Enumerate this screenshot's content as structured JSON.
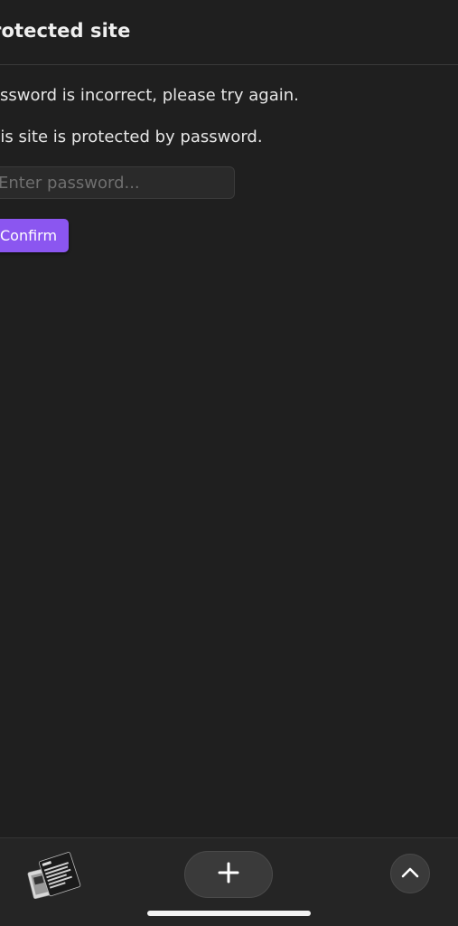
{
  "header": {
    "title": "rotected site"
  },
  "content": {
    "error_message": "assword is incorrect, please try again.",
    "info_message": "his site is protected by password.",
    "password_input": {
      "value": "",
      "placeholder": "Enter password..."
    },
    "confirm_label": "Confirm"
  },
  "toolbar": {
    "tabs_icon": "tab-thumbnails-icon",
    "add_icon": "plus-icon",
    "scroll_up_icon": "chevron-up-icon"
  },
  "colors": {
    "background": "#1f1f1f",
    "accent": "#8b56f0",
    "toolbar": "#252525"
  }
}
